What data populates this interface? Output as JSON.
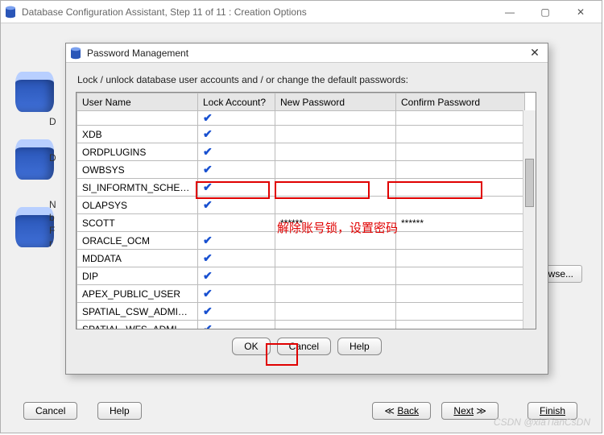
{
  "outer": {
    "title": "Database Configuration Assistant, Step 11 of 11 : Creation Options",
    "buttons": {
      "cancel": "Cancel",
      "help": "Help",
      "back": "Back",
      "next": "Next",
      "finish": "Finish"
    },
    "browse": "Browse...",
    "hints": {
      "d1": "D",
      "d2": "D",
      "n": "N",
      "b": "b",
      "f": "F",
      "r": "r"
    }
  },
  "inner": {
    "title": "Password Management",
    "instruction": "Lock / unlock database user accounts and / or change the default passwords:",
    "headers": {
      "user": "User Name",
      "lock": "Lock Account?",
      "newpw": "New Password",
      "confirm": "Confirm Password"
    },
    "rows": [
      {
        "user": "XDB",
        "locked": true,
        "newpw": "",
        "confirm": ""
      },
      {
        "user": "ORDPLUGINS",
        "locked": true,
        "newpw": "",
        "confirm": ""
      },
      {
        "user": "OWBSYS",
        "locked": true,
        "newpw": "",
        "confirm": ""
      },
      {
        "user": "SI_INFORMTN_SCHEMA",
        "locked": true,
        "newpw": "",
        "confirm": ""
      },
      {
        "user": "OLAPSYS",
        "locked": true,
        "newpw": "",
        "confirm": ""
      },
      {
        "user": "SCOTT",
        "locked": false,
        "newpw": "******",
        "confirm": "******"
      },
      {
        "user": "ORACLE_OCM",
        "locked": true,
        "newpw": "",
        "confirm": ""
      },
      {
        "user": "MDDATA",
        "locked": true,
        "newpw": "",
        "confirm": ""
      },
      {
        "user": "DIP",
        "locked": true,
        "newpw": "",
        "confirm": ""
      },
      {
        "user": "APEX_PUBLIC_USER",
        "locked": true,
        "newpw": "",
        "confirm": ""
      },
      {
        "user": "SPATIAL_CSW_ADMIN_...",
        "locked": true,
        "newpw": "",
        "confirm": ""
      },
      {
        "user": "SPATIAL_WFS_ADMIN_U...",
        "locked": true,
        "newpw": "",
        "confirm": ""
      }
    ],
    "buttons": {
      "ok": "OK",
      "cancel": "Cancel",
      "help": "Help"
    }
  },
  "annotation": {
    "text": "解除账号锁，设置密码"
  },
  "watermark": "CSDN @xiaTianCsDN"
}
